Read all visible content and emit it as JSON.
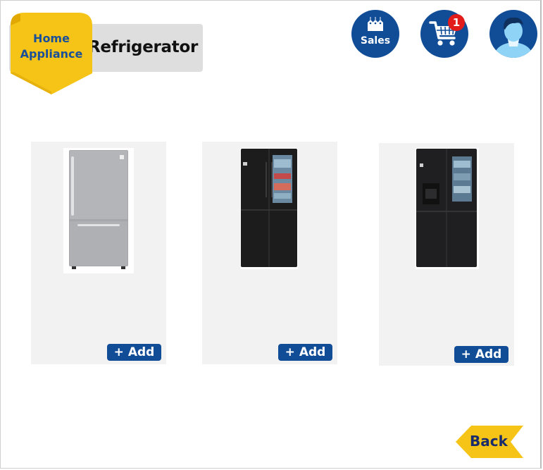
{
  "header": {
    "ribbon_line1": "Home",
    "ribbon_line2": "Appliance",
    "title": "Refrigerator",
    "sales_label": "Sales",
    "cart_count": "1"
  },
  "products": [
    {
      "name": "bottom-freezer-refrigerator",
      "add_label": "+ Add"
    },
    {
      "name": "black-french-door-refrigerator",
      "add_label": "+ Add"
    },
    {
      "name": "black-french-door-refrigerator-with-dispenser",
      "add_label": "+ Add"
    }
  ],
  "footer": {
    "back_label": "Back"
  },
  "colors": {
    "brand_blue": "#114c97",
    "ribbon_yellow": "#f5c417",
    "badge_red": "#e21b1b",
    "card_bg": "#f2f2f2"
  },
  "icons": [
    "price-tags-icon",
    "shopping-cart-icon",
    "user-avatar-icon"
  ]
}
